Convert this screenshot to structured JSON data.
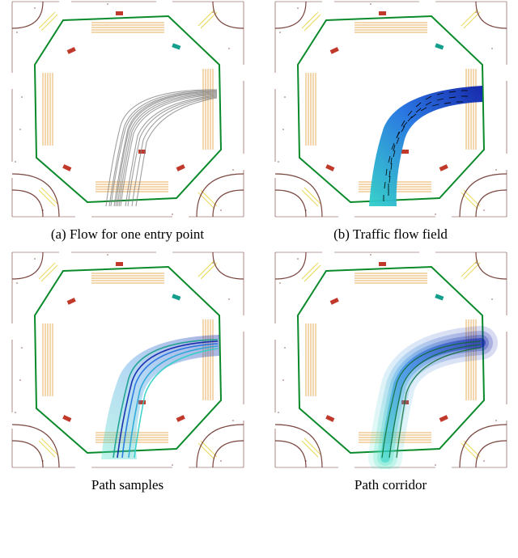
{
  "panels": [
    {
      "key": "a",
      "label": "(a) Flow for one entry point"
    },
    {
      "key": "b",
      "label": "(b) Traffic flow field"
    },
    {
      "key": "c",
      "label": "Path samples"
    },
    {
      "key": "d",
      "label": "Path corridor"
    }
  ],
  "colors": {
    "octagon": "#0a8a2a",
    "grey": "#808080",
    "orange": "#e6a23c",
    "yellow": "#e8d447",
    "darkred": "#5a1a12",
    "blue_dark": "#0b1ea8",
    "blue_mid": "#1f6fe0",
    "cyan": "#2fd0c8",
    "teal": "#149e8c"
  }
}
